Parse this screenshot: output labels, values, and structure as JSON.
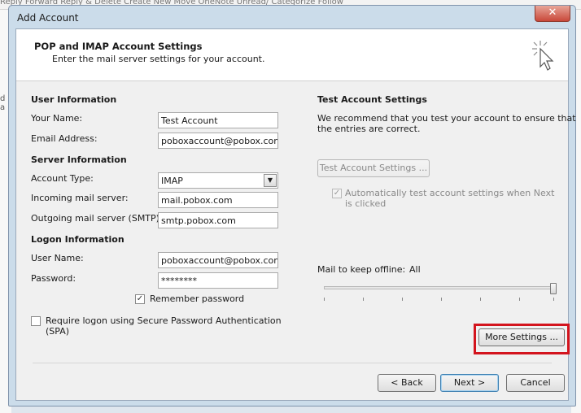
{
  "background": {
    "toolbar_text": "Reply   Forward          Reply & Delete          Create New                         Move   OneNote      Unread/  Categorize  Follow",
    "side_text": "d a"
  },
  "window": {
    "title": "Add Account",
    "close_glyph": "✕"
  },
  "header": {
    "title": "POP and IMAP Account Settings",
    "subtitle": "Enter the mail server settings for your account."
  },
  "user_info": {
    "heading": "User Information",
    "name_label": "Your Name:",
    "name_value": "Test Account",
    "email_label": "Email Address:",
    "email_value": "poboxaccount@pobox.com"
  },
  "server_info": {
    "heading": "Server Information",
    "account_type_label": "Account Type:",
    "account_type_value": "IMAP",
    "incoming_label": "Incoming mail server:",
    "incoming_value": "mail.pobox.com",
    "outgoing_label": "Outgoing mail server (SMTP):",
    "outgoing_value": "smtp.pobox.com"
  },
  "logon_info": {
    "heading": "Logon Information",
    "username_label": "User Name:",
    "username_value": "poboxaccount@pobox.com",
    "password_label": "Password:",
    "password_value": "********",
    "remember_label": "Remember password",
    "remember_checked": true,
    "spa_label_line1": "Require logon using Secure Password Authentication",
    "spa_label_line2": "(SPA)",
    "spa_checked": false
  },
  "test_settings": {
    "heading": "Test Account Settings",
    "desc_line1": "We recommend that you test your account to ensure that",
    "desc_line2": "the entries are correct.",
    "test_button": "Test Account Settings ...",
    "auto_test_line1": "Automatically test account settings when Next",
    "auto_test_line2": "is clicked",
    "auto_test_checked": true
  },
  "offline": {
    "label": "Mail to keep offline:",
    "value": "All",
    "slider_position": 1.0
  },
  "buttons": {
    "more_settings": "More Settings ...",
    "back": "< Back",
    "next": "Next >",
    "cancel": "Cancel"
  },
  "colors": {
    "highlight": "#d3141d",
    "window_frame": "#cbdcea"
  }
}
